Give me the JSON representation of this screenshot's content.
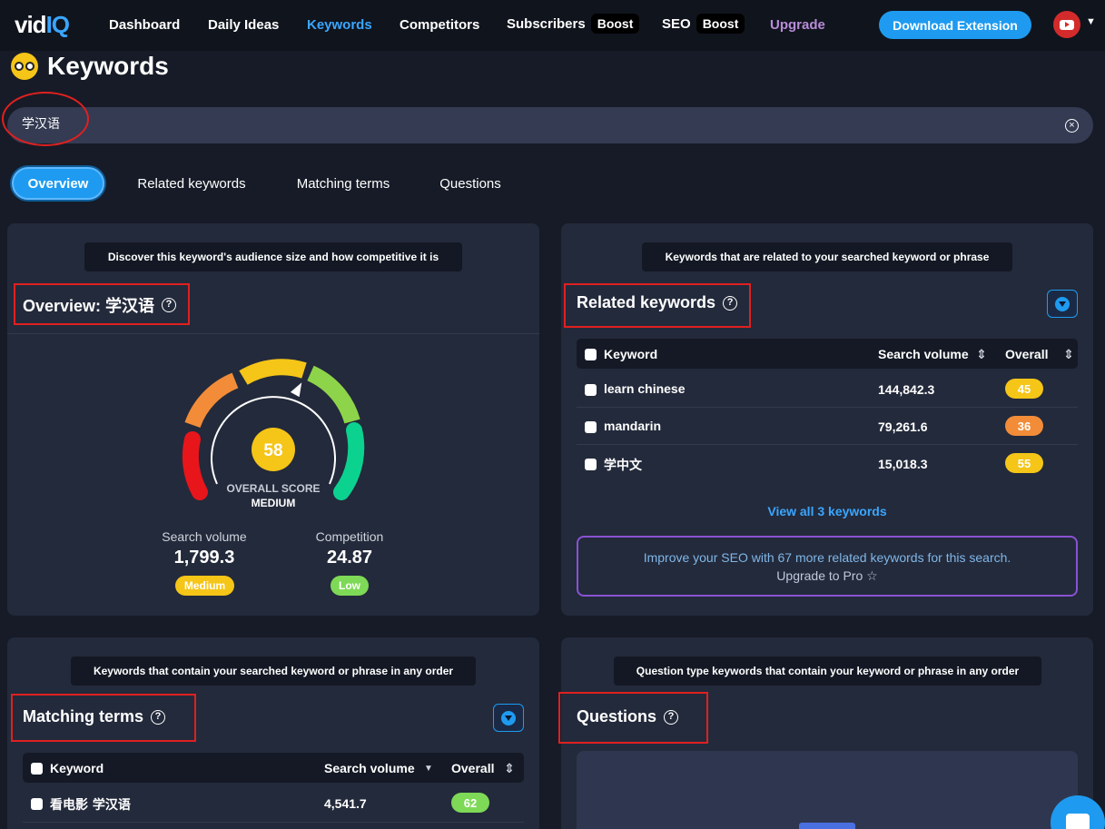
{
  "nav": {
    "logo_left": "vid",
    "logo_right": "IQ",
    "items": [
      {
        "label": "Dashboard"
      },
      {
        "label": "Daily Ideas"
      },
      {
        "label": "Keywords"
      },
      {
        "label": "Competitors"
      },
      {
        "label": "Subscribers",
        "badge": "Boost"
      },
      {
        "label": "SEO",
        "badge": "Boost"
      },
      {
        "label": "Upgrade"
      }
    ],
    "download_label": "Download Extension",
    "channel_icon": "youtube-icon"
  },
  "page": {
    "title": "Keywords"
  },
  "search": {
    "value": "学汉语"
  },
  "tabs": [
    {
      "label": "Overview",
      "active": true
    },
    {
      "label": "Related keywords"
    },
    {
      "label": "Matching terms"
    },
    {
      "label": "Questions"
    }
  ],
  "overview": {
    "hint": "Discover this keyword's audience size and how competitive it is",
    "title": "Overview: 学汉语",
    "score": "58",
    "score_label": "OVERALL SCORE",
    "score_level": "MEDIUM",
    "search_volume_label": "Search volume",
    "search_volume_value": "1,799.3",
    "search_volume_badge": "Medium",
    "competition_label": "Competition",
    "competition_value": "24.87",
    "competition_badge": "Low",
    "colors": {
      "score": "#f5c518",
      "medium": "#f5c518",
      "low": "#7ed957"
    }
  },
  "related": {
    "hint": "Keywords that are related to your searched keyword or phrase",
    "title": "Related keywords",
    "columns": [
      "Keyword",
      "Search volume",
      "Overall"
    ],
    "rows": [
      {
        "keyword": "learn chinese",
        "volume": "144,842.3",
        "overall": "45",
        "color": "#f5c518"
      },
      {
        "keyword": "mandarin",
        "volume": "79,261.6",
        "overall": "36",
        "color": "#f28c38"
      },
      {
        "keyword": "学中文",
        "volume": "15,018.3",
        "overall": "55",
        "color": "#f5c518"
      }
    ],
    "view_all": "View all 3 keywords",
    "upgrade_line1": "Improve your SEO with 67 more related keywords for this search.",
    "upgrade_line2": "Upgrade to Pro ☆"
  },
  "matching": {
    "hint": "Keywords that contain your searched keyword or phrase in any order",
    "title": "Matching terms",
    "columns": [
      "Keyword",
      "Search volume",
      "Overall"
    ],
    "rows": [
      {
        "keyword": "看电影 学汉语",
        "volume": "4,541.7",
        "overall": "62",
        "color": "#7ed957"
      }
    ]
  },
  "questions": {
    "hint": "Question type keywords that contain your keyword or phrase in any order",
    "title": "Questions"
  }
}
